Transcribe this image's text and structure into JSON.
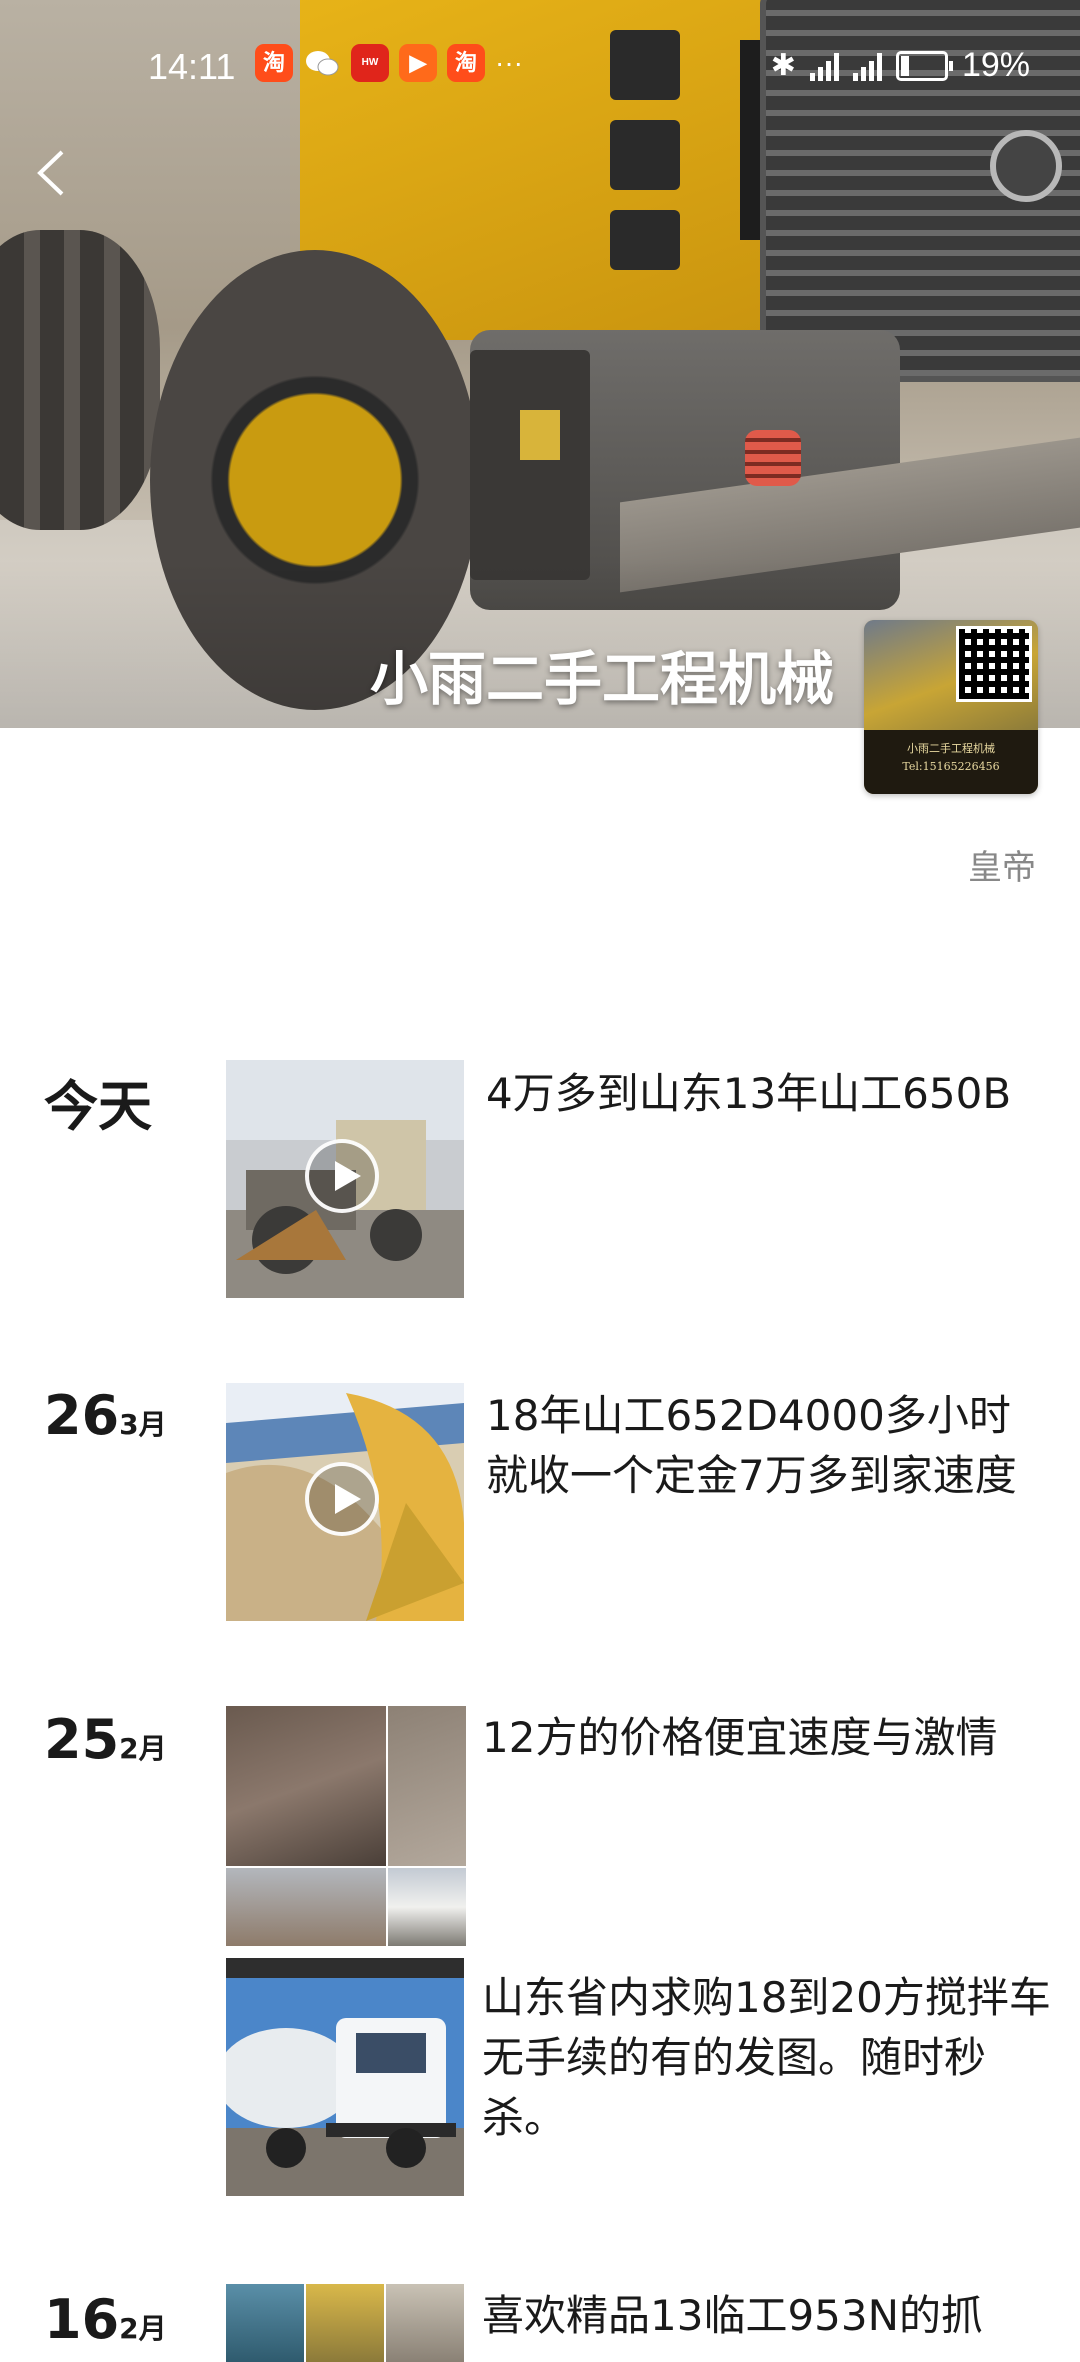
{
  "status_bar": {
    "time": "14:11",
    "apps": [
      {
        "icon": "taobao-icon",
        "text": "淘",
        "color": "#ff4d1a"
      },
      {
        "icon": "wechat-icon",
        "text": "",
        "color": "#ffffff"
      },
      {
        "icon": "huawei-icon",
        "text": "",
        "color": "#e0251b"
      },
      {
        "icon": "video-icon",
        "text": "",
        "color": "#ff6a1a"
      },
      {
        "icon": "taobao-icon",
        "text": "淘",
        "color": "#ff4d1a"
      }
    ],
    "more": "···",
    "battery": "19%",
    "battery_level": 0.19
  },
  "header": {
    "name": "小雨二手工程机械",
    "signature": "皇帝",
    "avatar_text": "小雨二手工程机械",
    "avatar_phone": "Tel:15165226456"
  },
  "posts": [
    {
      "day": "今天",
      "month": "",
      "text": "4万多到山东13年山工650B",
      "media": "video"
    },
    {
      "day": "26",
      "month": "3月",
      "text": "18年山工652D4000多小时就收一个定金7万多到家速度",
      "media": "video"
    },
    {
      "day": "25",
      "month": "2月",
      "text": "12方的价格便宜速度与激情",
      "media": "grid"
    },
    {
      "day": "",
      "month": "",
      "text": "山东省内求购18到20方搅拌车无手续的有的发图。随时秒杀。",
      "media": "image"
    },
    {
      "day": "16",
      "month": "2月",
      "text": "喜欢精品13临工953N的抓",
      "media": "grid"
    }
  ],
  "colors": {
    "accent_yellow": "#e8b418",
    "text": "#1a1a1a",
    "muted": "#888888"
  }
}
